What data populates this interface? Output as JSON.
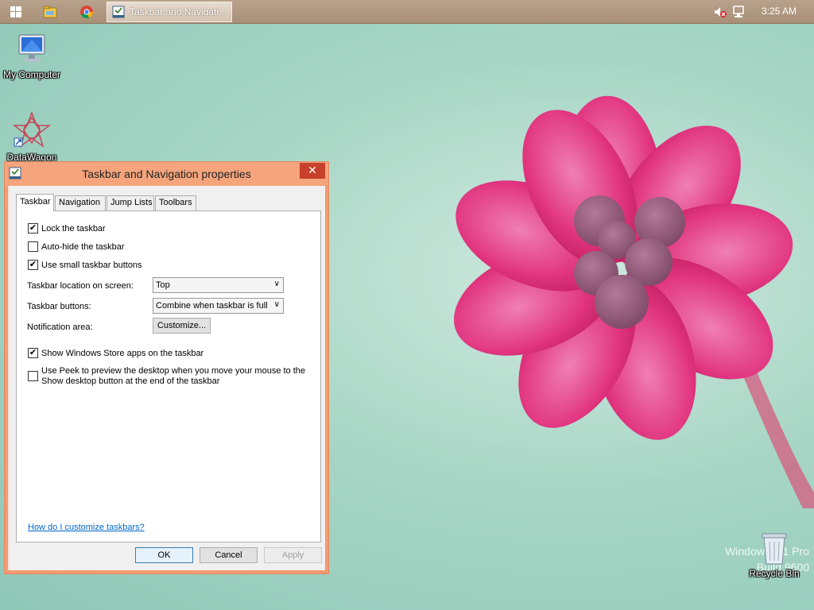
{
  "taskbar": {
    "active_window_label": "Taskbar and Navigati...",
    "clock": "3:25 AM",
    "icons": [
      "windows-start-icon",
      "file-explorer-icon",
      "chrome-icon",
      "speaker-muted-icon",
      "network-icon"
    ]
  },
  "desktop": {
    "icons": {
      "my_computer": "My Computer",
      "datawagon": "DataWagon",
      "recycle_bin": "Recycle Bin"
    },
    "watermark": {
      "line1": "Windows 8.1 Pro",
      "line2": "Build 9600"
    }
  },
  "dialog": {
    "title": "Taskbar and Navigation properties",
    "close_glyph": "✕",
    "tabs": [
      {
        "label": "Taskbar",
        "active": true
      },
      {
        "label": "Navigation",
        "active": false
      },
      {
        "label": "Jump Lists",
        "active": false
      },
      {
        "label": "Toolbars",
        "active": false
      }
    ],
    "checkboxes": {
      "lock": {
        "label": "Lock the taskbar",
        "checked": true
      },
      "autohide": {
        "label": "Auto-hide the taskbar",
        "checked": false
      },
      "small": {
        "label": "Use small taskbar buttons",
        "checked": true
      },
      "store_apps": {
        "label": "Show Windows Store apps on the taskbar",
        "checked": true
      },
      "peek": {
        "line1": "Use Peek to preview the desktop when you move your mouse to the",
        "line2": "Show desktop button at the end of the taskbar",
        "checked": false
      }
    },
    "location": {
      "label": "Taskbar location on screen:",
      "value": "Top"
    },
    "buttons_setting": {
      "label": "Taskbar buttons:",
      "value": "Combine when taskbar is full"
    },
    "notification": {
      "label": "Notification area:",
      "button": "Customize..."
    },
    "help_link": "How do I customize taskbars?",
    "footer": {
      "ok": "OK",
      "cancel": "Cancel",
      "apply": "Apply"
    }
  },
  "colors": {
    "title_bar": "#f5a47c",
    "close_button": "#c7402b",
    "link": "#0066cc"
  }
}
